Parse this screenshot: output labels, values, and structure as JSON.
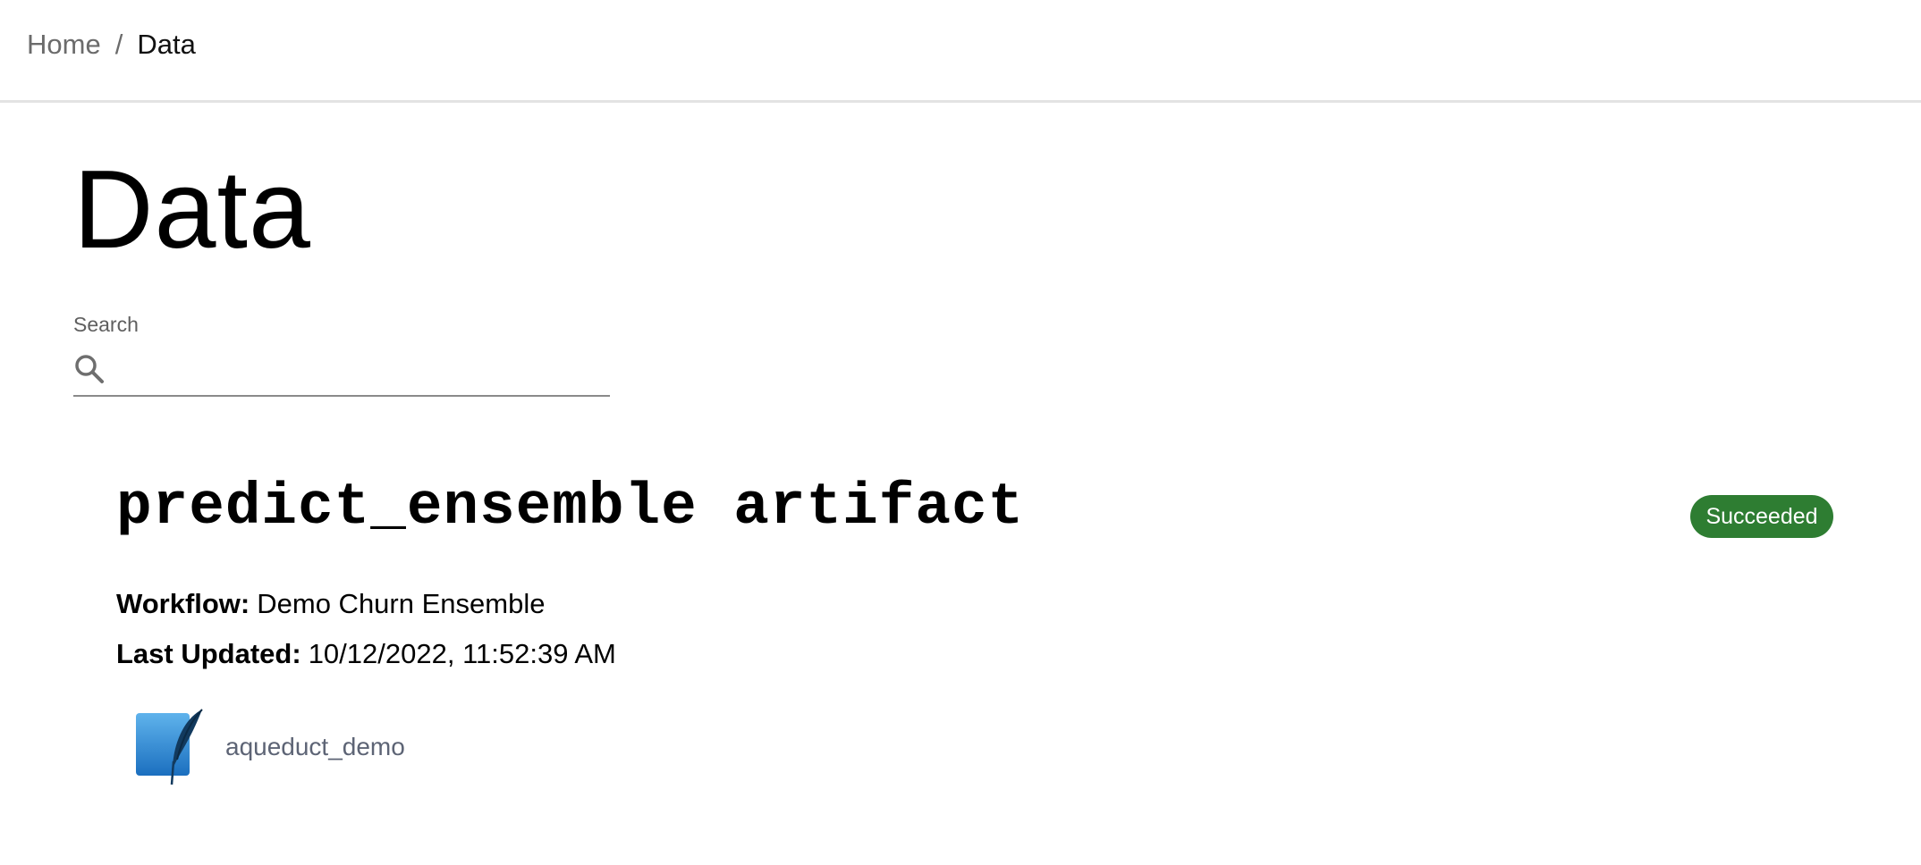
{
  "breadcrumb": {
    "home": "Home",
    "separator": "/",
    "current": "Data"
  },
  "page": {
    "title": "Data"
  },
  "search": {
    "label": "Search",
    "value": "",
    "placeholder": "",
    "icon": "search-icon"
  },
  "artifact": {
    "title": "predict_ensemble artifact",
    "status": "Succeeded",
    "status_color": "#2e7d32",
    "workflow_label": "Workflow:",
    "workflow_value": "Demo Churn Ensemble",
    "updated_label": "Last Updated:",
    "updated_value": "10/12/2022, 11:52:39 AM",
    "integration": {
      "icon": "sqlite-icon",
      "name": "aqueduct_demo"
    }
  }
}
